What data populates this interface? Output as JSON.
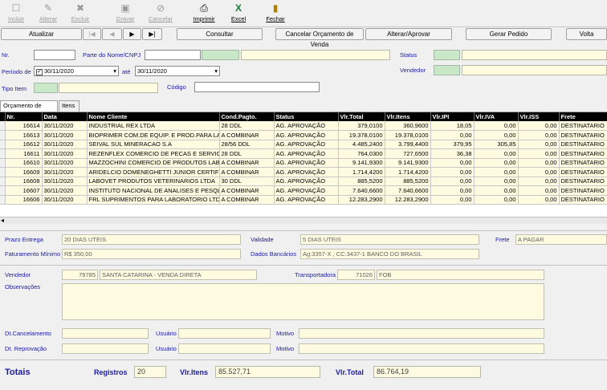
{
  "toolbar": {
    "incluir": "Incluir",
    "alterar": "Alterar",
    "excluir": "Excluir",
    "gravar": "Gravar",
    "cancelar": "Cancelar",
    "imprimir": "Imprimir",
    "excel": "Excel",
    "fechar": "Fechar"
  },
  "actions": {
    "atualizar": "Atualizar",
    "nav_first": "|◀",
    "nav_prev": "◀",
    "nav_next": "▶",
    "nav_last": "▶|",
    "consultar": "Consultar",
    "cancelar_orcamento": "Cancelar Orçamento de Venda",
    "alterar_aprovar": "Alterar/Aprovar",
    "gerar_pedido": "Gerar Pedido",
    "voltar": "Volta"
  },
  "filters": {
    "nr_label": "Nr.",
    "parte_nome_label": "Parte do Nome/CNPJ",
    "status_label": "Status",
    "periodo_label": "Período de",
    "periodo_de": "30/11/2020",
    "ate_label": "até",
    "periodo_ate": "30/11/2020",
    "vendedor_label": "Vendedor",
    "tipo_item_label": "Tipo Item",
    "codigo_label": "Código"
  },
  "tabs": [
    "Orçamento de Venda",
    "Itens"
  ],
  "grid": {
    "columns": [
      "Nr.",
      "Data",
      "Nome Cliente",
      "Cond.Pagto.",
      "Status",
      "Vlr.Total",
      "Vlr.Itens",
      "Vlr.IPI",
      "Vlr.IVA",
      "Vlr.ISS",
      "Frete"
    ],
    "rows": [
      [
        "16614",
        "30/11/2020",
        "INDUSTRIAL REX LTDA",
        "28 DDL",
        "AG. APROVAÇÃO",
        "379,0100",
        "360,9600",
        "18,05",
        "0,00",
        "0,00",
        "DESTINATARIO"
      ],
      [
        "16613",
        "30/11/2020",
        "BIOPRIMER COM.DE EQUIP. E PROD.PARA LA",
        "A COMBINAR",
        "AG. APROVAÇÃO",
        "19.378,0100",
        "19.378,0100",
        "0,00",
        "0,00",
        "0,00",
        "DESTINATARIO"
      ],
      [
        "16612",
        "30/11/2020",
        "SEIVAL SUL MINERACAO S.A",
        "28/56 DDL",
        "AG. APROVAÇÃO",
        "4.485,2400",
        "3.799,4400",
        "379,95",
        "305,85",
        "0,00",
        "DESTINATARIO"
      ],
      [
        "16611",
        "30/11/2020",
        "REZENFLEX COMERCIO DE PECAS E SERVICO",
        "28 DDL",
        "AG. APROVAÇÃO",
        "764,0300",
        "727,6500",
        "36,38",
        "0,00",
        "0,00",
        "DESTINATARIO"
      ],
      [
        "16610",
        "30/11/2020",
        "MAZZOCHINI COMERCIO DE PRODUTOS LABCA",
        "A COMBINAR",
        "AG. APROVAÇÃO",
        "9.141,9300",
        "9.141,9300",
        "0,00",
        "0,00",
        "0,00",
        "DESTINATARIO"
      ],
      [
        "16609",
        "30/11/2020",
        "ARIDELCIO DOMENEGHETTI JUNIOR CERTIFIA",
        "A COMBINAR",
        "AG. APROVAÇÃO",
        "1.714,4200",
        "1.714,4200",
        "0,00",
        "0,00",
        "0,00",
        "DESTINATARIO"
      ],
      [
        "16608",
        "30/11/2020",
        "LABOVET PRODUTOS VETERINARIOS LTDA",
        "30 DDL",
        "AG. APROVAÇÃO",
        "885,5200",
        "885,5200",
        "0,00",
        "0,00",
        "0,00",
        "DESTINATARIO"
      ],
      [
        "16607",
        "30/11/2020",
        "INSTITUTO NACIONAL DE ANALISES E PESQLA",
        "A COMBINAR",
        "AG. APROVAÇÃO",
        "7.640,6600",
        "7.640,6600",
        "0,00",
        "0,00",
        "0,00",
        "DESTINATARIO"
      ],
      [
        "16606",
        "30/11/2020",
        "FRL SUPRIMENTOS PARA LABORATORIO LTDA",
        "A COMBINAR",
        "AG. APROVAÇÃO",
        "12.283,2900",
        "12.283,2900",
        "0,00",
        "0,00",
        "0,00",
        "DESTINATARIO"
      ]
    ]
  },
  "details": {
    "prazo_entrega_label": "Prazo Entrega",
    "prazo_entrega": "20  DIAS UTEIS",
    "validade_label": "Validade",
    "validade": "5 DIAS UTEIS",
    "frete_label": "Frete",
    "frete": "A PAGAR",
    "faturamento_label": "Faturamento Mínimo",
    "faturamento": "R$ 350,00",
    "dados_bancarios_label": "Dados Bancários",
    "dados_bancarios": "Ag:3357-X , CC:3437-1 BANCO DO BRASIL",
    "vendedor_label": "Vendedor",
    "vendedor_code": "79785",
    "vendedor_name": "SANTA CATARINA - VENDA DIRETA",
    "transportadora_label": "Transportadora",
    "transportadora_code": "71026",
    "transportadora_name": "FOB",
    "observacoes_label": "Observações",
    "dt_cancelamento_label": "Dt.Cancelamento",
    "dt_reprovacao_label": "Dt. Reprovação",
    "usuario_label": "Usuário",
    "motivo_label": "Motivo"
  },
  "totals": {
    "title": "Totais",
    "registros_label": "Registros",
    "registros": "20",
    "vlr_itens_label": "Vlr.Itens",
    "vlr_itens": "85.527,71",
    "vlr_total_label": "Vlr.Total",
    "vlr_total": "86.764,19"
  }
}
